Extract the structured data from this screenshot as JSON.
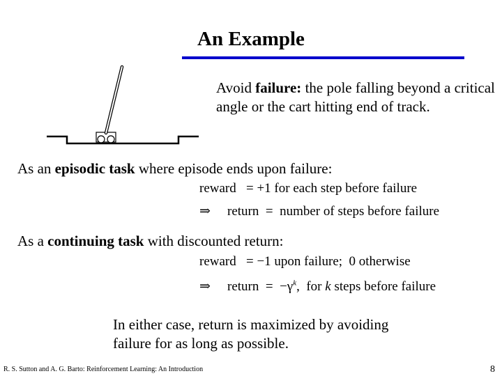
{
  "slide": {
    "title": "An Example",
    "accent_color": "#0000cc",
    "figure": {
      "description": "cart-pole on a track",
      "icon": "cart-pole-diagram"
    },
    "avoid_text": {
      "prefix": "Avoid ",
      "bold": "failure:",
      "suffix": " the pole falling beyond a critical angle or the cart hitting end of track."
    },
    "episodic": {
      "prefix": "As an ",
      "bold": "episodic task",
      "suffix": " where episode ends upon failure:",
      "eq1": "reward   = +1 for each step before failure",
      "eq2_arrow": "⇒",
      "eq2": "return  =  number of steps before failure"
    },
    "continuing": {
      "prefix": "As  a ",
      "bold": "continuing task",
      "suffix": " with discounted return:",
      "eq1": "reward   = −1 upon failure;  0 otherwise",
      "eq2_arrow": "⇒",
      "eq2_pre": "return  =  −γ",
      "eq2_sup": "k",
      "eq2_mid": ",  for ",
      "eq2_k": "k",
      "eq2_post": " steps before failure"
    },
    "conclusion": "In either case, return is maximized by avoiding failure for as long as possible.",
    "footer": "R. S. Sutton and A. G. Barto: Reinforcement Learning: An Introduction",
    "page_number": "8"
  }
}
